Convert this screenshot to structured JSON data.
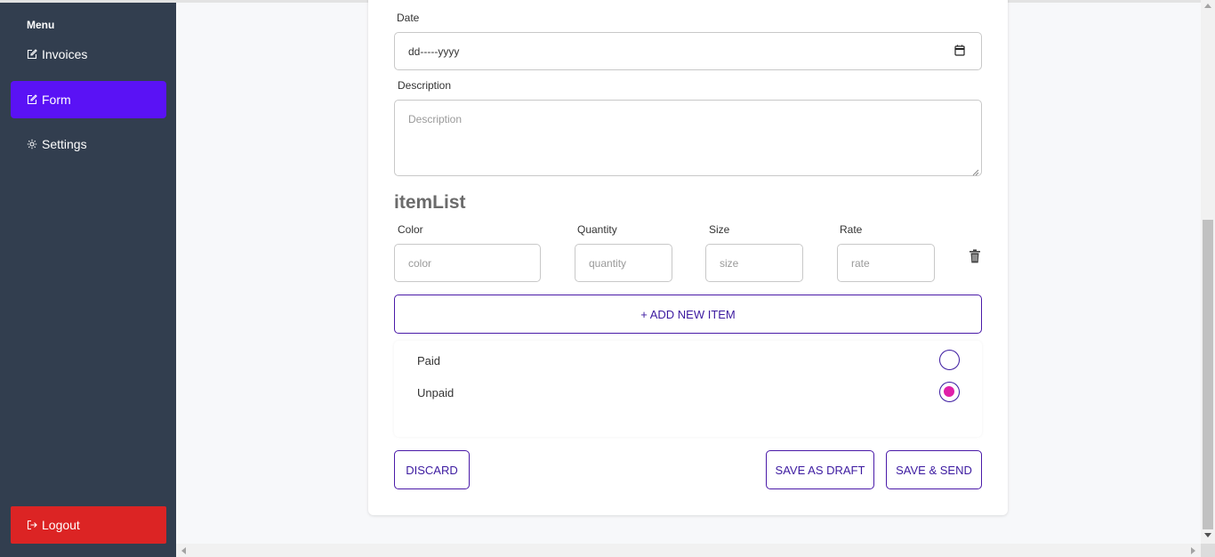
{
  "sidebar": {
    "menu_title": "Menu",
    "items": [
      {
        "label": "Invoices",
        "icon": "edit-icon"
      },
      {
        "label": "Form",
        "icon": "edit-icon",
        "active": true
      },
      {
        "label": "Settings",
        "icon": "gear-icon"
      }
    ],
    "logout": {
      "label": "Logout",
      "icon": "logout-icon"
    }
  },
  "form": {
    "date": {
      "label": "Date",
      "value": "dd-----yyyy"
    },
    "description": {
      "label": "Description",
      "placeholder": "Description"
    },
    "item_list": {
      "title": "itemList",
      "columns": [
        {
          "label": "Color",
          "placeholder": "color"
        },
        {
          "label": "Quantity",
          "placeholder": "quantity"
        },
        {
          "label": "Size",
          "placeholder": "size"
        },
        {
          "label": "Rate",
          "placeholder": "rate"
        }
      ]
    },
    "add_item_label": "+ ADD NEW ITEM",
    "status": {
      "options": [
        {
          "label": "Paid",
          "checked": false
        },
        {
          "label": "Unpaid",
          "checked": true
        }
      ]
    },
    "buttons": {
      "discard": "DISCARD",
      "save_draft": "SAVE AS DRAFT",
      "save_send": "SAVE & SEND"
    }
  },
  "colors": {
    "sidebar_bg": "#323e4f",
    "active_nav": "#5a12f5",
    "logout_bg": "#dc2424",
    "accent": "#3c1aa0",
    "radio_checked": "#e01fa9"
  }
}
